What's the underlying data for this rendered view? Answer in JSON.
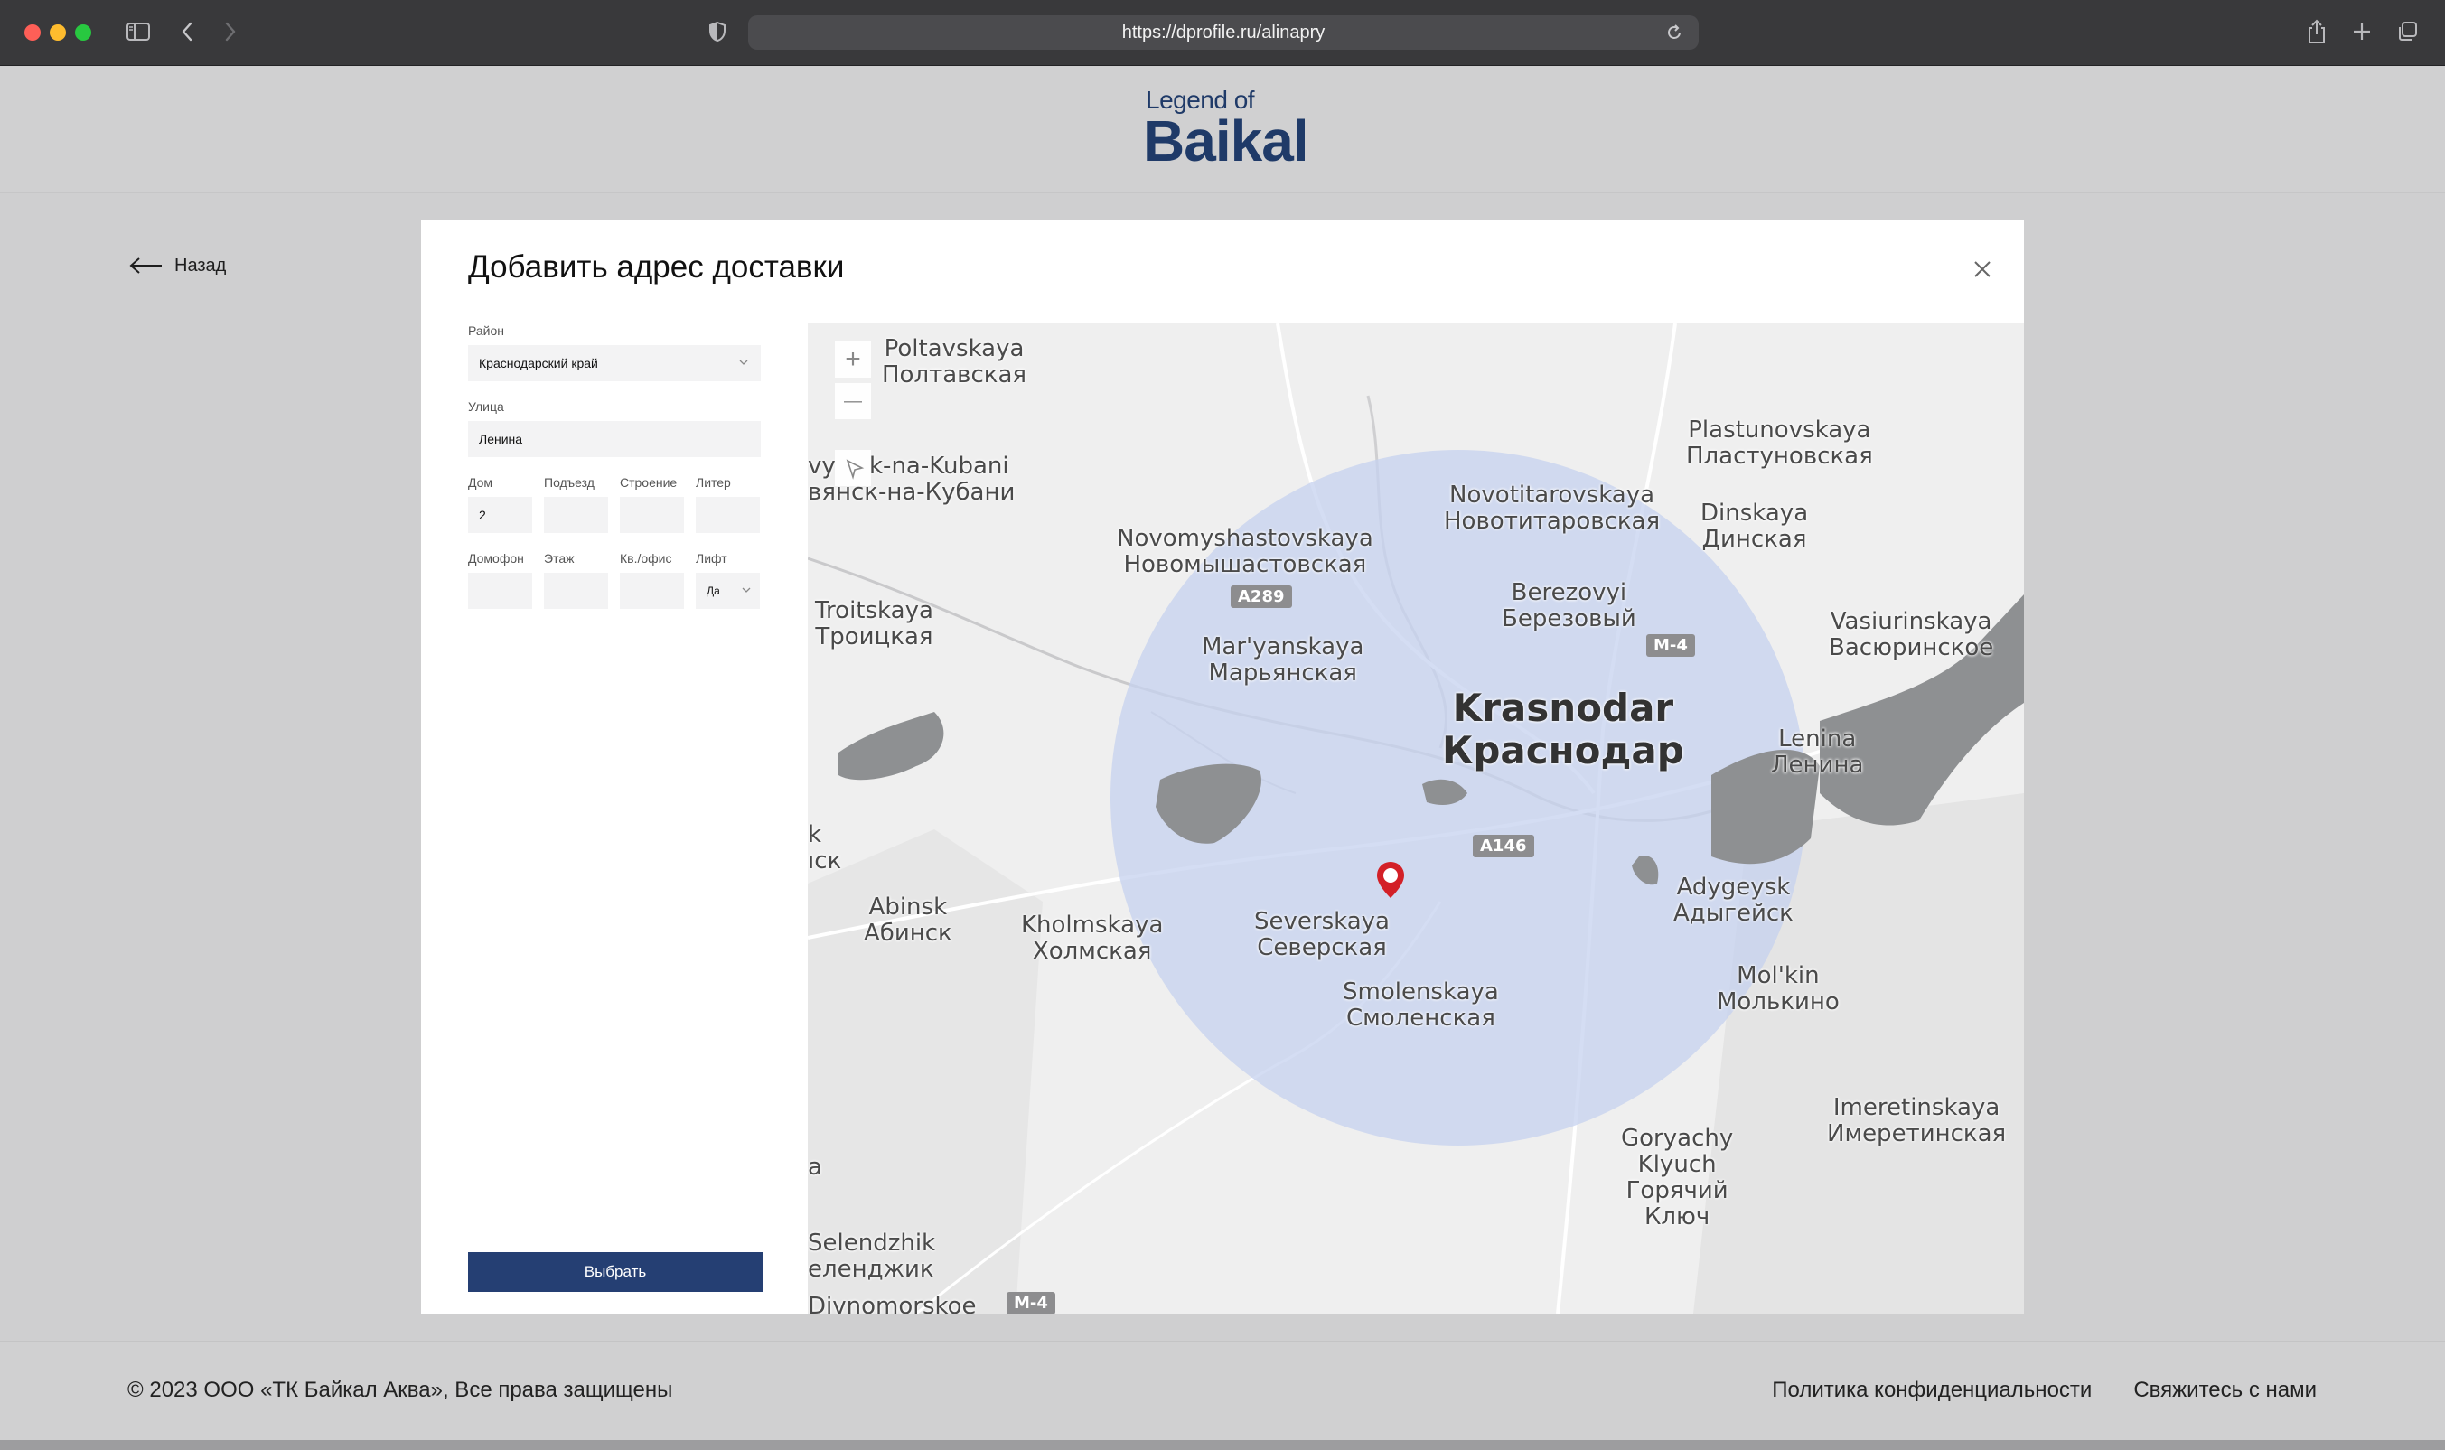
{
  "browser": {
    "url": "https://dprofile.ru/alinapry"
  },
  "site": {
    "logo_small": "Legend of",
    "logo_big": "Baikal",
    "brand_color": "#1f3a68"
  },
  "nav": {
    "back_label": "Назад"
  },
  "modal": {
    "title": "Добавить адрес доставки",
    "fields": {
      "region_label": "Район",
      "region_value": "Краснодарский край",
      "street_label": "Улица",
      "street_value": "Ленина",
      "house_label": "Дом",
      "house_value": "2",
      "entrance_label": "Подъезд",
      "entrance_value": "",
      "building_label": "Строение",
      "building_value": "",
      "liter_label": "Литер",
      "liter_value": "",
      "intercom_label": "Домофон",
      "intercom_value": "",
      "floor_label": "Этаж",
      "floor_value": "",
      "apartment_label": "Кв./офис",
      "apartment_value": "",
      "lift_label": "Лифт",
      "lift_value": "Да"
    },
    "submit_label": "Выбрать",
    "submit_color": "#253f73"
  },
  "map": {
    "zoom_in": "+",
    "zoom_out": "—",
    "labels": [
      {
        "key": "poltavskaya",
        "lines": [
          "Poltavskaya",
          "Полтавская"
        ]
      },
      {
        "key": "slavyansk",
        "lines": [
          "k-na-Kubani",
          "вянск-на-Кубани"
        ]
      },
      {
        "key": "vy",
        "lines": [
          "vy"
        ]
      },
      {
        "key": "plastunovskaya",
        "lines": [
          "Plastunovskaya",
          "Пластуновская"
        ]
      },
      {
        "key": "novotitarovskaya",
        "lines": [
          "Novotitarovskaya",
          "Новотитаровская"
        ]
      },
      {
        "key": "dinskaya",
        "lines": [
          "Dinskaya",
          "Динская"
        ]
      },
      {
        "key": "novomyshastovskaya",
        "lines": [
          "Novomyshastovskaya",
          "Новомышастовская"
        ]
      },
      {
        "key": "troitskaya",
        "lines": [
          "Troitskaya",
          "Троицкая"
        ]
      },
      {
        "key": "berezovyi",
        "lines": [
          "Berezovyi",
          "Березовый"
        ]
      },
      {
        "key": "vasiurinskaya",
        "lines": [
          "Vasiurinskaya",
          "Васюринское"
        ]
      },
      {
        "key": "maryanskaya",
        "lines": [
          "Mar'yanskaya",
          "Марьянская"
        ]
      },
      {
        "key": "lenina",
        "lines": [
          "Lenina",
          "Ленина"
        ]
      },
      {
        "key": "k_left",
        "lines": [
          "k",
          "ıск"
        ]
      },
      {
        "key": "adygeysk",
        "lines": [
          "Adygeysk",
          "Адыгейск"
        ]
      },
      {
        "key": "abinsk",
        "lines": [
          "Abinsk",
          "Абинск"
        ]
      },
      {
        "key": "kholmskaya",
        "lines": [
          "Kholmskaya",
          "Холмская"
        ]
      },
      {
        "key": "severskaya",
        "lines": [
          "Severskaya",
          "Северская"
        ]
      },
      {
        "key": "molkin",
        "lines": [
          "Mol'kin",
          "Молькино"
        ]
      },
      {
        "key": "smolenskaya",
        "lines": [
          "Smolenskaya",
          "Смоленская"
        ]
      },
      {
        "key": "imeretinskaya",
        "lines": [
          "Imeretinskaya",
          "Имеретинская"
        ]
      },
      {
        "key": "goryachy",
        "lines": [
          "Goryachy",
          "Klyuch",
          "Горячий",
          "Ключ"
        ]
      },
      {
        "key": "a_left",
        "lines": [
          "a"
        ]
      },
      {
        "key": "gelendzhik",
        "lines": [
          "Selendzhik",
          "еленджик"
        ]
      },
      {
        "key": "divnomorskoe",
        "lines": [
          "Divnomorskoe"
        ]
      }
    ],
    "main_city": [
      "Krasnodar",
      "Краснодар"
    ],
    "roads": [
      "A289",
      "M-4",
      "A146",
      "M-4"
    ],
    "radius_color": "#c5d0ee",
    "pin_color": "#d32027"
  },
  "footer": {
    "copyright": "© 2023   ООО «ТК Байкал Аква», Все права защищены",
    "privacy": "Политика конфиденциальности",
    "contact": "Свяжитесь с нами"
  }
}
